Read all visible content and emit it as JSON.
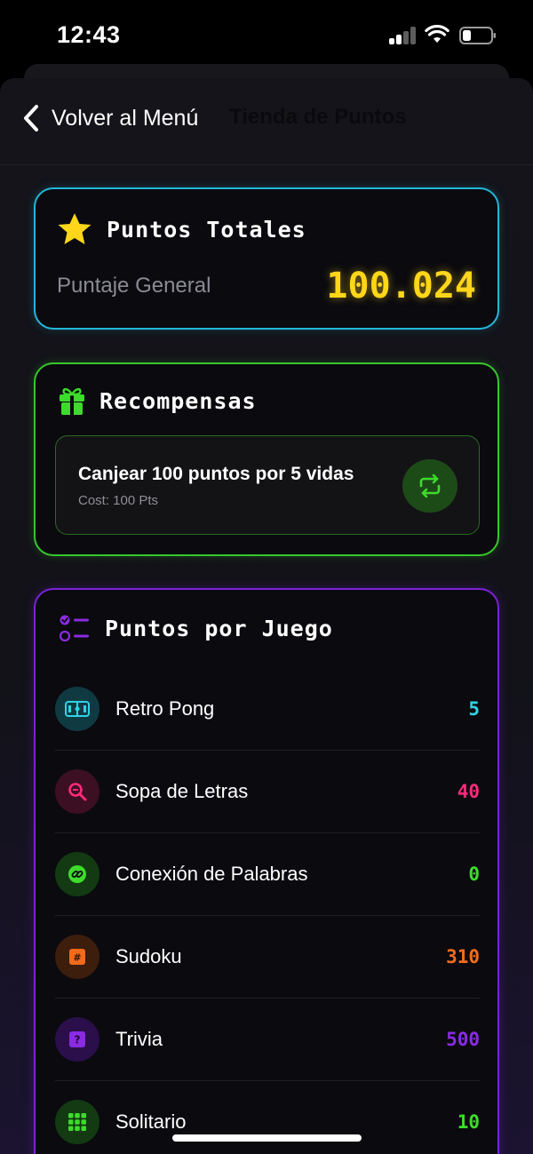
{
  "status_bar": {
    "time": "12:43"
  },
  "nav": {
    "back_label": "Volver al Menú",
    "title": "Tienda de Puntos"
  },
  "total_card": {
    "title": "Puntos Totales",
    "label": "Puntaje General",
    "value": "100.024",
    "accent": "#23b7d8",
    "value_color": "#ffd61a"
  },
  "rewards_card": {
    "title": "Recompensas",
    "accent": "#36c82a",
    "item": {
      "title": "Canjear 100 puntos por 5 vidas",
      "cost": "Cost: 100 Pts"
    }
  },
  "games_card": {
    "title": "Puntos por Juego",
    "accent": "#7b22d8",
    "games": [
      {
        "name": "Retro Pong",
        "points": "5",
        "color": "#2ed3e6",
        "icon": "pong-icon"
      },
      {
        "name": "Sopa de Letras",
        "points": "40",
        "color": "#ff2a7a",
        "icon": "magnifier-icon"
      },
      {
        "name": "Conexión de Palabras",
        "points": "0",
        "color": "#3ddc2b",
        "icon": "link-icon"
      },
      {
        "name": "Sudoku",
        "points": "310",
        "color": "#f26b1d",
        "icon": "hash-icon"
      },
      {
        "name": "Trivia",
        "points": "500",
        "color": "#8a2be2",
        "icon": "question-icon"
      },
      {
        "name": "Solitario",
        "points": "10",
        "color": "#3ddc2b",
        "icon": "grid-icon"
      }
    ]
  }
}
